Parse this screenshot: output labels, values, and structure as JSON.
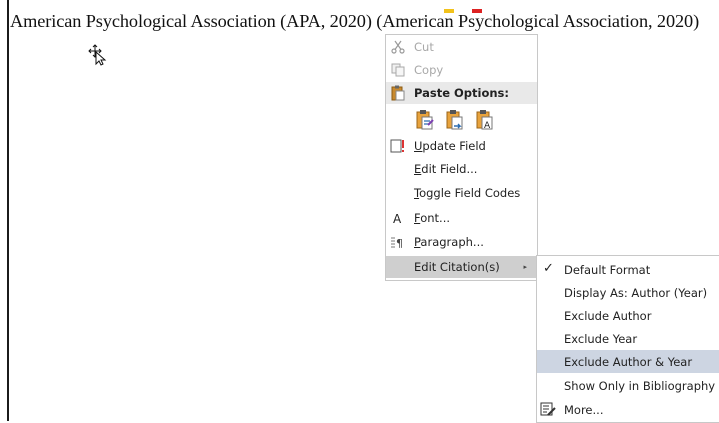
{
  "document": {
    "citation_text": "American Psychological Association (APA, 2020) (",
    "field_text": "American Psychological Association, 2020)"
  },
  "context_menu": {
    "items": [
      {
        "label": "Cut",
        "icon": "scissors-icon",
        "disabled": true
      },
      {
        "label": "Copy",
        "icon": "copy-icon",
        "disabled": true
      },
      {
        "label": "Paste Options:",
        "icon": "paste-icon"
      },
      {
        "label": "Update Field",
        "icon": "update-field-icon"
      },
      {
        "label": "Edit Field...",
        "icon": ""
      },
      {
        "label": "Toggle Field Codes",
        "icon": ""
      },
      {
        "label": "Font...",
        "icon": "font-icon"
      },
      {
        "label": "Paragraph...",
        "icon": "paragraph-icon"
      },
      {
        "label": "Edit Citation(s)",
        "icon": "",
        "has_submenu": true
      }
    ],
    "submenu_arrow": "▸"
  },
  "citation_submenu": {
    "items": [
      {
        "label": "Default Format",
        "checked": true
      },
      {
        "label": "Display As: Author (Year)"
      },
      {
        "label": "Exclude Author"
      },
      {
        "label": "Exclude Year"
      },
      {
        "label": "Exclude Author & Year",
        "highlighted": true
      },
      {
        "label": "Show Only in Bibliography"
      },
      {
        "label": "More...",
        "icon": "edit-citation-icon"
      }
    ],
    "check_mark": "✓"
  },
  "colors": {
    "menu_highlight": "#cfcfcf",
    "submenu_highlight": "#cdd5e2",
    "paste_header_bg": "#e9e9e9",
    "icon_orange": "#e8a33d",
    "icon_blue": "#2b6cb0"
  }
}
